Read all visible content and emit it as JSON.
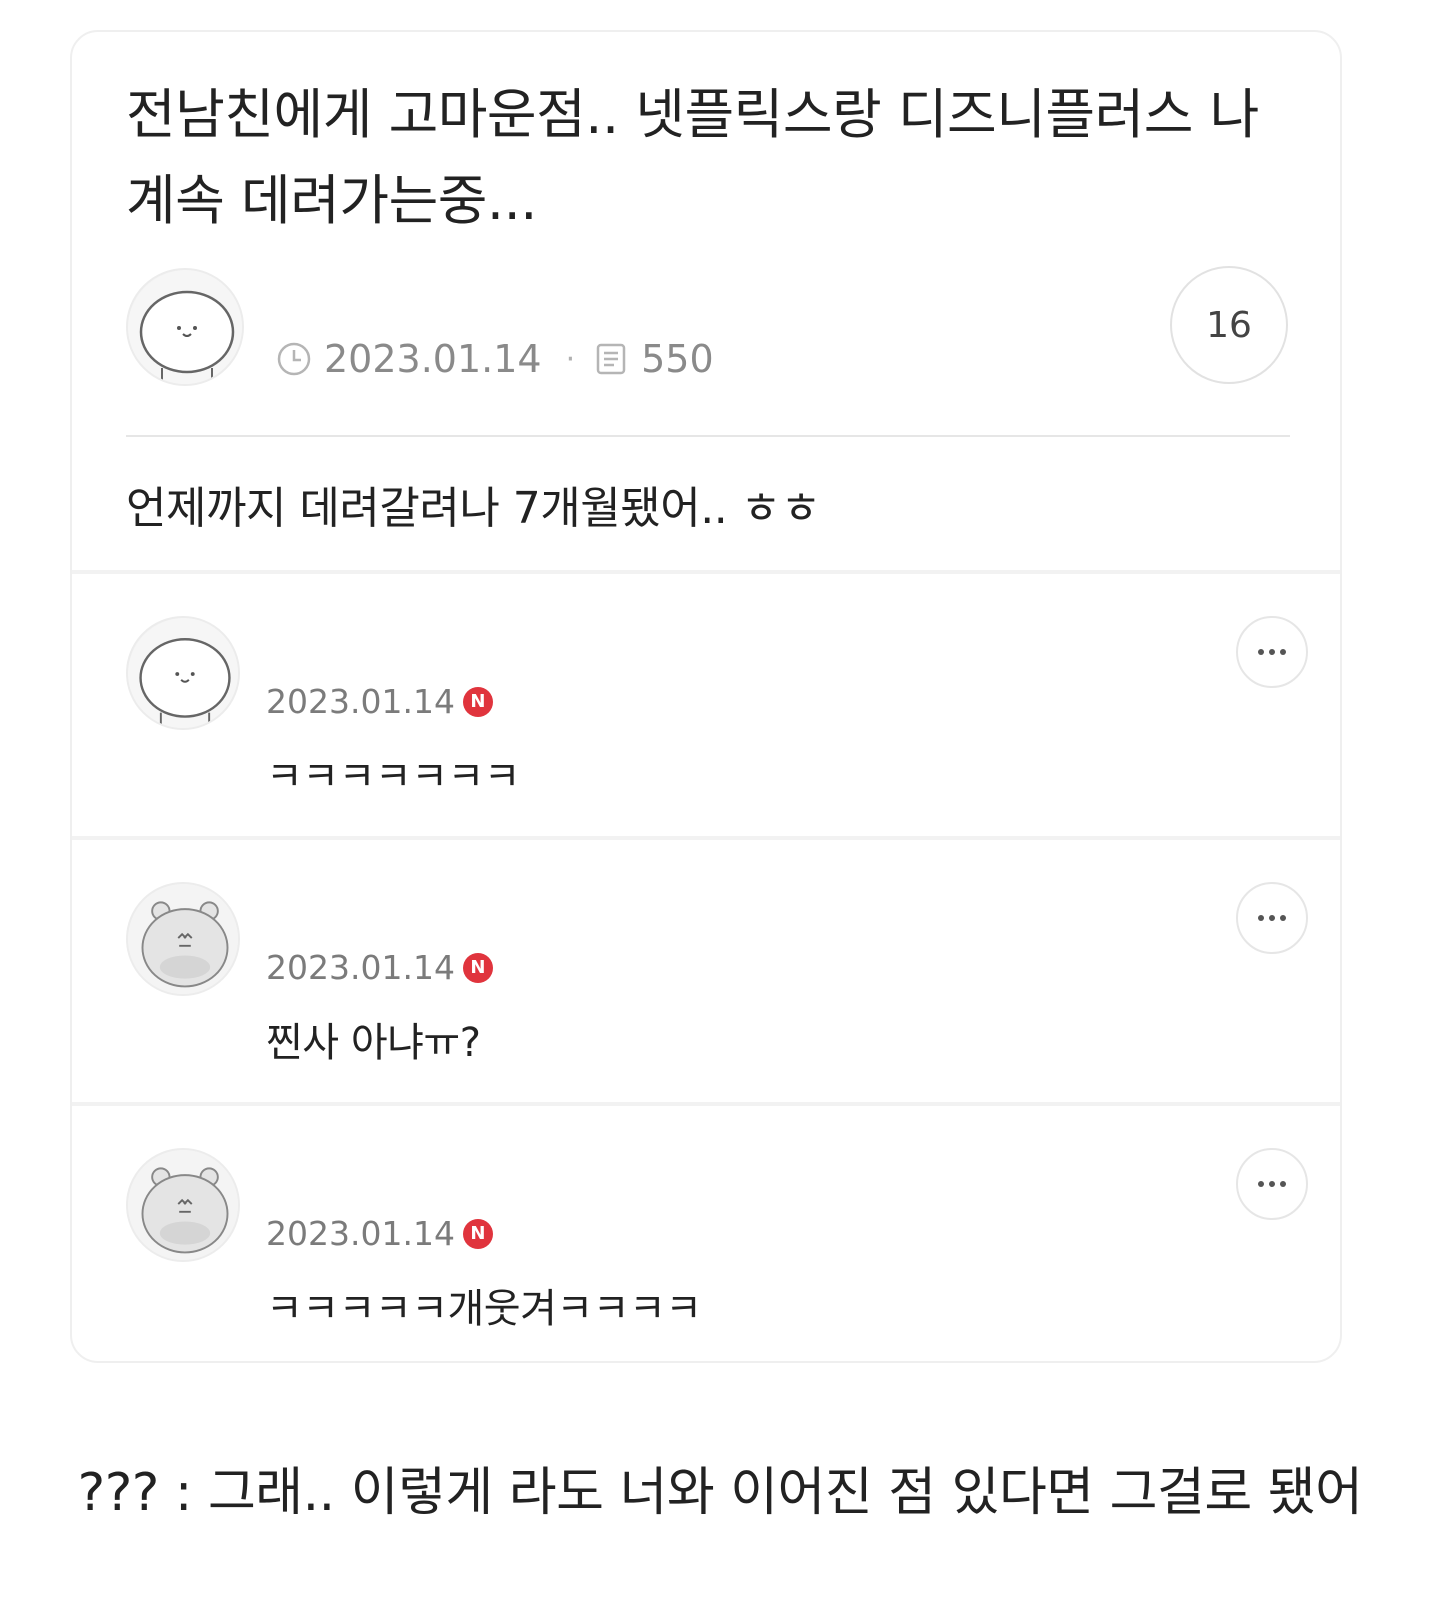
{
  "post": {
    "title": "전남친에게 고마운점.. 넷플릭스랑 디즈니플러스 나 계속 데려가는중...",
    "date": "2023.01.14",
    "views": "550",
    "comment_count": "16",
    "body": "언제까지 데려갈려나 7개월됐어.. ㅎㅎ"
  },
  "comments": [
    {
      "date": "2023.01.14",
      "badge": "N",
      "text": "ㅋㅋㅋㅋㅋㅋㅋ",
      "avatar_icon": "round-face-avatar-icon"
    },
    {
      "date": "2023.01.14",
      "badge": "N",
      "text": "찐사 아냐ㅠ?",
      "avatar_icon": "bear-avatar-icon"
    },
    {
      "date": "2023.01.14",
      "badge": "N",
      "text": "ㅋㅋㅋㅋㅋ개웃겨ㅋㅋㅋㅋ",
      "avatar_icon": "bear-avatar-icon"
    }
  ],
  "caption": "??? : 그래.. 이렇게 라도 너와 이어진 점 있다면 그걸로 됐어",
  "colors": {
    "new_badge": "#e0343d",
    "meta_text": "#8a8a8a",
    "border": "#efefef"
  }
}
